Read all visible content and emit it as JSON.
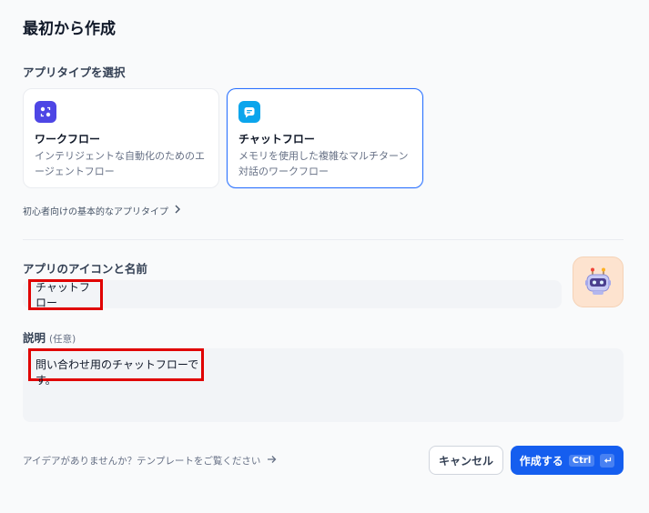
{
  "title": "最初から作成",
  "app_type": {
    "label": "アプリタイプを選択",
    "cards": [
      {
        "name": "ワークフロー",
        "description": "インテリジェントな自動化のためのエージェントフロー",
        "icon": "workflow-icon",
        "selected": false
      },
      {
        "name": "チャットフロー",
        "description": "メモリを使用した複雑なマルチターン対話のワークフロー",
        "icon": "chatflow-icon",
        "selected": true
      }
    ],
    "beginner_link": "初心者向けの基本的なアプリタイプ"
  },
  "name_field": {
    "label": "アプリのアイコンと名前",
    "value": "チャットフロー",
    "app_icon": "robot-emoji-icon"
  },
  "description_field": {
    "label": "説明",
    "optional": "(任意)",
    "value": "問い合わせ用のチャットフローです。"
  },
  "footer": {
    "idea_link": "アイデアがありませんか？テンプレートをご覧ください",
    "cancel_label": "キャンセル",
    "create_label": "作成する",
    "shortcut_key": "Ctrl"
  },
  "colors": {
    "primary": "#155eef",
    "selected_border": "#2970ff",
    "highlight_box": "#e00000",
    "workflow_icon_bg": "#4e46e5",
    "chatflow_icon_bg": "#0ba5ec"
  }
}
